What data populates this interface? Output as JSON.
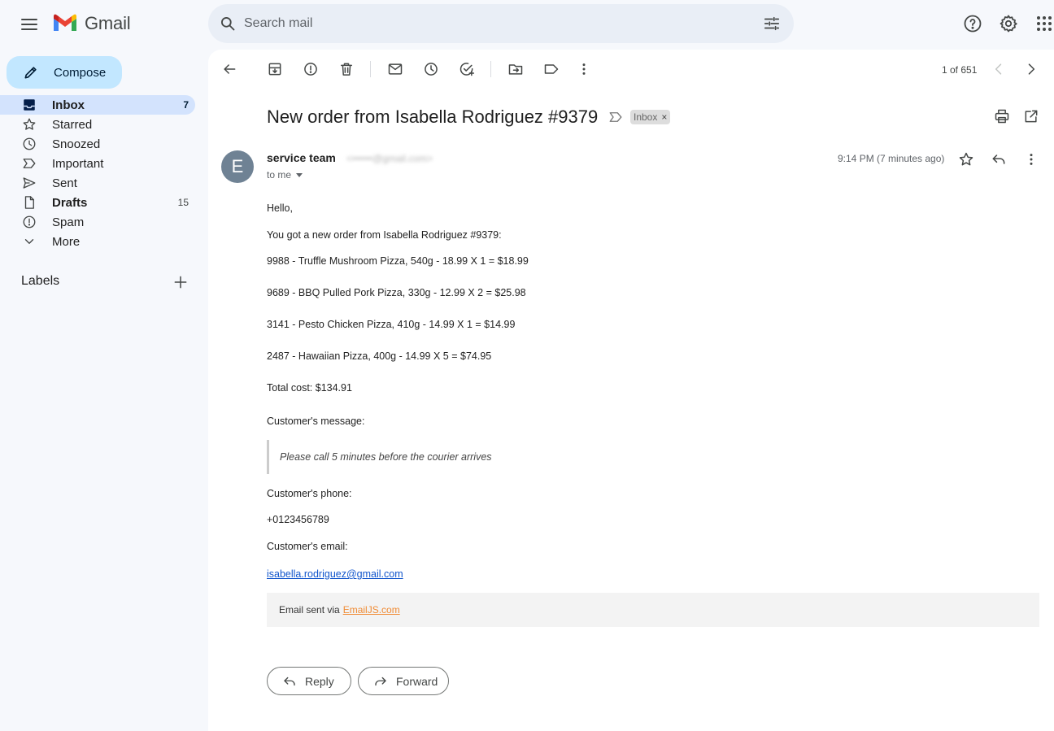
{
  "app": {
    "name": "Gmail"
  },
  "search": {
    "placeholder": "Search mail"
  },
  "compose": {
    "label": "Compose"
  },
  "nav": [
    {
      "label": "Inbox",
      "count": "7",
      "icon": "inbox-icon"
    },
    {
      "label": "Starred",
      "count": "",
      "icon": "star-icon"
    },
    {
      "label": "Snoozed",
      "count": "",
      "icon": "clock-icon"
    },
    {
      "label": "Important",
      "count": "",
      "icon": "label-important-icon"
    },
    {
      "label": "Sent",
      "count": "",
      "icon": "send-icon"
    },
    {
      "label": "Drafts",
      "count": "15",
      "icon": "draft-icon"
    },
    {
      "label": "Spam",
      "count": "",
      "icon": "report-icon"
    },
    {
      "label": "More",
      "count": "",
      "icon": "chevron-down-icon"
    }
  ],
  "labels": {
    "title": "Labels"
  },
  "pager": {
    "text": "1 of 651"
  },
  "email": {
    "subject": "New order from Isabella Rodriguez #9379",
    "chip": "Inbox",
    "chip_close": "×",
    "avatar_letter": "E",
    "sender_name": "service team",
    "sender_email": "<••••••@gmail.com>",
    "to": "to me",
    "time": "9:14 PM (7 minutes ago)",
    "greeting": "Hello,",
    "intro": "You got a new order from Isabella Rodriguez #9379:",
    "items": [
      "9988 - Truffle Mushroom Pizza, 540g - 18.99 X 1 = $18.99",
      "9689 - BBQ Pulled Pork Pizza, 330g - 12.99 X 2 = $25.98",
      "3141 - Pesto Chicken Pizza, 410g - 14.99 X 1 = $14.99",
      "2487 - Hawaiian Pizza, 400g - 14.99 X 5 = $74.95"
    ],
    "total": "Total cost: $134.91",
    "message_label": "Customer's message:",
    "message": "Please call 5 minutes before the courier arrives",
    "phone_label": "Customer's phone:",
    "phone": "+0123456789",
    "email_label": "Customer's email:",
    "customer_email": "isabella.rodriguez@gmail.com",
    "footer_text": "Email sent via",
    "footer_link": "EmailJS.com"
  },
  "actions": {
    "reply": "Reply",
    "forward": "Forward"
  },
  "colors": {
    "sidebar_bg": "#f6f8fc",
    "compose_bg": "#c2e7ff",
    "active_nav_bg": "#d3e3fd",
    "avatar_bg": "#6f8294",
    "link": "#1155cc",
    "footer_link": "#f08b34"
  }
}
